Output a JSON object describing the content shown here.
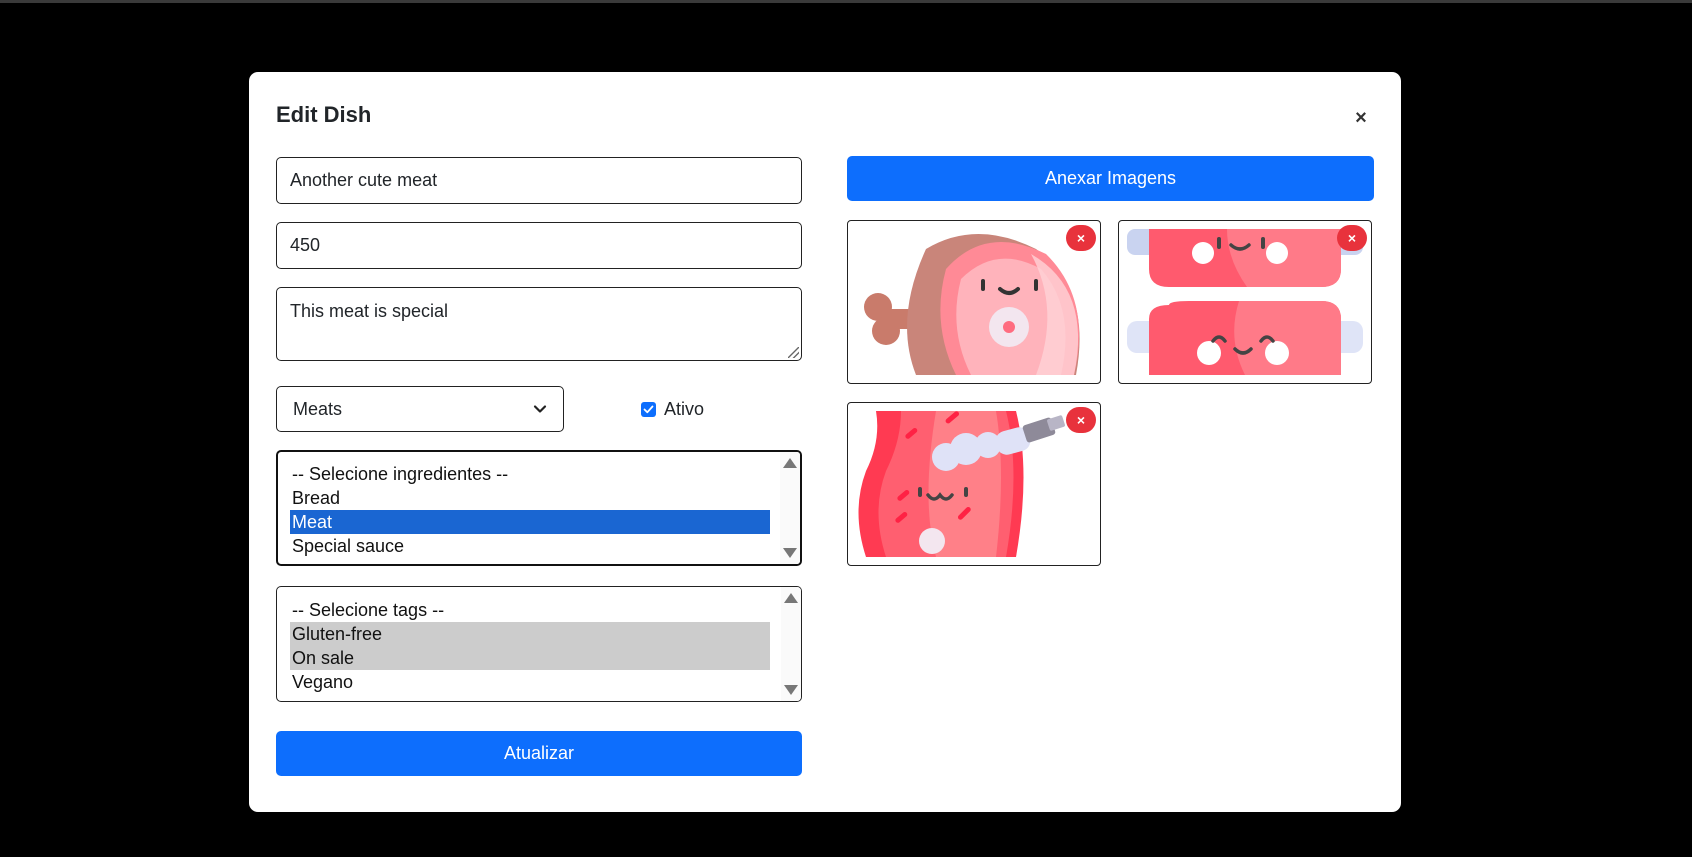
{
  "modal": {
    "title": "Edit Dish",
    "close_label": "×"
  },
  "form": {
    "name_value": "Another cute meat",
    "price_value": "450",
    "description_value": "This meat is special",
    "category_value": "Meats",
    "active_label": "Ativo",
    "active_checked": true,
    "ingredients": [
      {
        "label": "-- Selecione ingredientes --",
        "selected": false
      },
      {
        "label": "Bread",
        "selected": false
      },
      {
        "label": "Meat",
        "selected": true
      },
      {
        "label": "Special sauce",
        "selected": false
      }
    ],
    "tags": [
      {
        "label": "-- Selecione tags --",
        "selected": false
      },
      {
        "label": "Gluten-free",
        "selected": true
      },
      {
        "label": "On sale",
        "selected": true
      },
      {
        "label": "Vegano",
        "selected": false
      }
    ],
    "submit_label": "Atualizar"
  },
  "images": {
    "attach_label": "Anexar Imagens",
    "remove_label": "×",
    "items": [
      {
        "icon": "ham-icon"
      },
      {
        "icon": "sausages-icon"
      },
      {
        "icon": "steak-sauce-icon"
      }
    ]
  },
  "colors": {
    "primary": "#0d6efd",
    "remove": "#e8323c",
    "overlay": "#000000",
    "listbox_selected": "#1a66d2",
    "listbox_inactive_selected": "#cccccc"
  }
}
